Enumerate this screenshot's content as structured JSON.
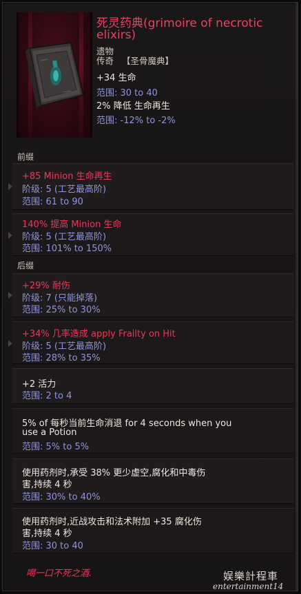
{
  "item": {
    "name_line1": "死灵药典(grimoire of necrotic",
    "name_line2": "elixirs)",
    "type": "遗物",
    "rarity": "传奇",
    "tag": "【圣骨魔典】",
    "name_color": "#e8435f"
  },
  "implicits": [
    {
      "value": "+34 生命",
      "range": "范围: 30 to 40"
    },
    {
      "value": "2% 降低 生命再生",
      "range": "范围: -12% to -2%"
    }
  ],
  "sections": {
    "prefix": "前缀",
    "suffix": "后缀"
  },
  "affixes": [
    {
      "title": "+85 Minion 生命再生",
      "tier": "阶级: 5 (工艺最高阶)",
      "range": "范围: 61 to 90"
    },
    {
      "title": "140% 提高 Minion 生命",
      "tier": "阶级: 5 (工艺最高阶)",
      "range": "范围: 101% to 150%"
    },
    {
      "title": "+29% 耐伤",
      "tier": "阶级: 7 (只能掉落)",
      "range": "范围: 25% to 30%"
    },
    {
      "title": "+34% 几率造成 apply Frailty on Hit",
      "tier": "阶级: 5 (工艺最高阶)",
      "range": "范围: 28% to 35%"
    }
  ],
  "uniques": [
    {
      "line1": "+2 活力",
      "line2": "",
      "range": "范围: 2 to 4"
    },
    {
      "line1": "5% of 每秒当前生命消退 for 4 seconds when you",
      "line2": "use a Potion",
      "range": "范围: 5% to 5%"
    },
    {
      "line1": "使用药剂时,承受 38% 更少虚空,腐化和中毒伤",
      "line2": "害,持续 4 秒",
      "range": "范围: 30% to 40%"
    },
    {
      "line1": "使用药剂时,近战攻击和法术附加 +35 腐化伤",
      "line2": "害,持续 4 秒",
      "range": "范围: 30 to 40"
    }
  ],
  "lore": "喝一口不死之酒.",
  "watermark": {
    "cn": "娱樂計程車",
    "en": "entertainment14"
  },
  "colors": {
    "affix_title": "#e9395a",
    "range_text": "#8e95d8",
    "panel_bg": "#201c1d"
  }
}
